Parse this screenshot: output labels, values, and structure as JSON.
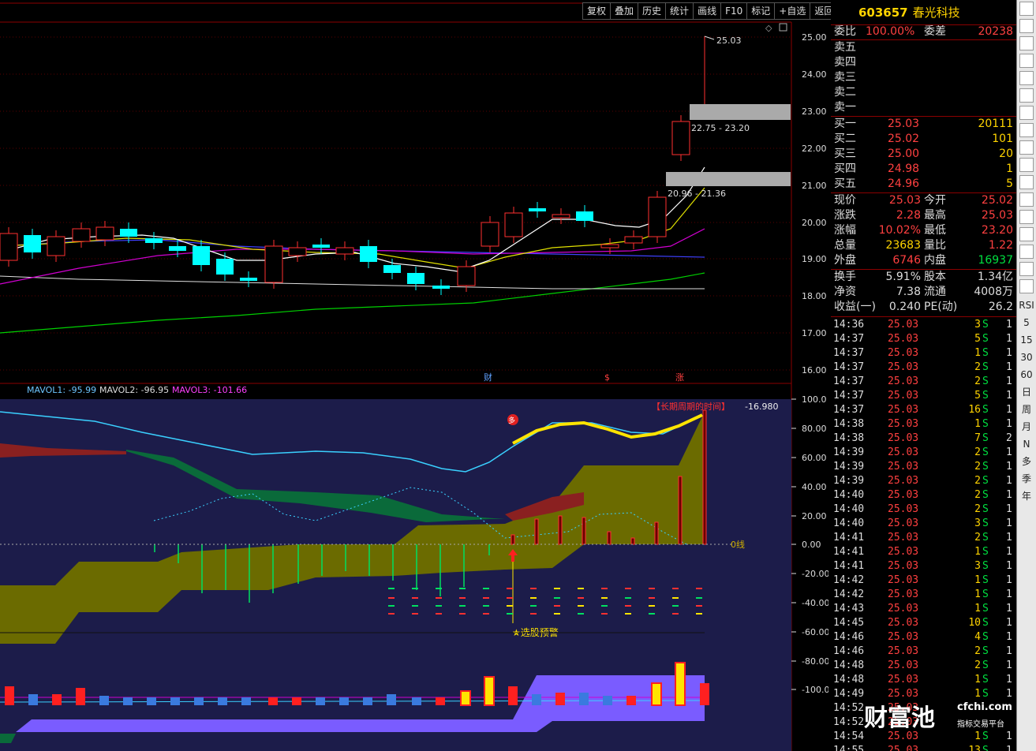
{
  "toolbar": [
    "复权",
    "叠加",
    "历史",
    "统计",
    "画线",
    "F10",
    "标记",
    "+自选",
    "返回"
  ],
  "stock": {
    "code": "603657",
    "name": "春光科技"
  },
  "price_axis": [
    "25.00",
    "24.00",
    "23.00",
    "22.00",
    "21.00",
    "20.00",
    "19.00",
    "18.00",
    "17.00",
    "16.00"
  ],
  "annotations": {
    "high": "25.03",
    "zone_upper": "22.75 - 23.20",
    "zone_lower": "20.96 - 21.36",
    "marker1": "财",
    "marker2": "$",
    "marker3": "涨"
  },
  "indicator": {
    "mavol1": "MAVOL1: -95.99",
    "mavol2": "MAVOL2: -96.95",
    "mavol3": "MAVOL3: -101.66",
    "title": "【长期周期的时间】",
    "value": "-16.980",
    "zero": "0线",
    "alert": "★选股预警",
    "badge": "多",
    "axis": [
      "100.0",
      "80.00",
      "60.00",
      "40.00",
      "20.00",
      "0.00",
      "-20.00",
      "-40.00",
      "-60.00",
      "-80.00",
      "-100.0"
    ]
  },
  "quote": {
    "weibi_label": "委比",
    "weibi": "100.00%",
    "weicha_label": "委差",
    "weicha": "20238",
    "asks": [
      {
        "l": "卖五",
        "p": "",
        "q": ""
      },
      {
        "l": "卖四",
        "p": "",
        "q": ""
      },
      {
        "l": "卖三",
        "p": "",
        "q": ""
      },
      {
        "l": "卖二",
        "p": "",
        "q": ""
      },
      {
        "l": "卖一",
        "p": "",
        "q": ""
      }
    ],
    "bids": [
      {
        "l": "买一",
        "p": "25.03",
        "q": "20111"
      },
      {
        "l": "买二",
        "p": "25.02",
        "q": "101"
      },
      {
        "l": "买三",
        "p": "25.00",
        "q": "20"
      },
      {
        "l": "买四",
        "p": "24.98",
        "q": "1"
      },
      {
        "l": "买五",
        "p": "24.96",
        "q": "5"
      }
    ],
    "stats": [
      {
        "l1": "现价",
        "v1": "25.03",
        "l2": "今开",
        "v2": "25.02"
      },
      {
        "l1": "涨跌",
        "v1": "2.28",
        "l2": "最高",
        "v2": "25.03"
      },
      {
        "l1": "涨幅",
        "v1": "10.02%",
        "l2": "最低",
        "v2": "23.20"
      },
      {
        "l1": "总量",
        "v1": "23683",
        "l2": "量比",
        "v2": "1.22"
      },
      {
        "l1": "外盘",
        "v1": "6746",
        "l2": "内盘",
        "v2": "16937"
      }
    ],
    "stats2": [
      {
        "l1": "换手",
        "v1": "5.91%",
        "l2": "股本",
        "v2": "1.34亿"
      },
      {
        "l1": "净资",
        "v1": "7.38",
        "l2": "流通",
        "v2": "4008万"
      },
      {
        "l1": "收益(一)",
        "v1": "0.240",
        "l2": "PE(动)",
        "v2": "26.2"
      }
    ]
  },
  "ticks": [
    {
      "t": "14:36",
      "p": "25.03",
      "q": "3",
      "s": "S",
      "n": "1"
    },
    {
      "t": "14:37",
      "p": "25.03",
      "q": "5",
      "s": "S",
      "n": "1"
    },
    {
      "t": "14:37",
      "p": "25.03",
      "q": "1",
      "s": "S",
      "n": "1"
    },
    {
      "t": "14:37",
      "p": "25.03",
      "q": "2",
      "s": "S",
      "n": "1"
    },
    {
      "t": "14:37",
      "p": "25.03",
      "q": "2",
      "s": "S",
      "n": "1"
    },
    {
      "t": "14:37",
      "p": "25.03",
      "q": "5",
      "s": "S",
      "n": "1"
    },
    {
      "t": "14:37",
      "p": "25.03",
      "q": "16",
      "s": "S",
      "n": "1"
    },
    {
      "t": "14:38",
      "p": "25.03",
      "q": "1",
      "s": "S",
      "n": "1"
    },
    {
      "t": "14:38",
      "p": "25.03",
      "q": "7",
      "s": "S",
      "n": "2"
    },
    {
      "t": "14:39",
      "p": "25.03",
      "q": "2",
      "s": "S",
      "n": "1"
    },
    {
      "t": "14:39",
      "p": "25.03",
      "q": "2",
      "s": "S",
      "n": "1"
    },
    {
      "t": "14:39",
      "p": "25.03",
      "q": "2",
      "s": "S",
      "n": "1"
    },
    {
      "t": "14:40",
      "p": "25.03",
      "q": "2",
      "s": "S",
      "n": "1"
    },
    {
      "t": "14:40",
      "p": "25.03",
      "q": "2",
      "s": "S",
      "n": "1"
    },
    {
      "t": "14:40",
      "p": "25.03",
      "q": "3",
      "s": "S",
      "n": "1"
    },
    {
      "t": "14:41",
      "p": "25.03",
      "q": "2",
      "s": "S",
      "n": "1"
    },
    {
      "t": "14:41",
      "p": "25.03",
      "q": "1",
      "s": "S",
      "n": "1"
    },
    {
      "t": "14:41",
      "p": "25.03",
      "q": "3",
      "s": "S",
      "n": "1"
    },
    {
      "t": "14:42",
      "p": "25.03",
      "q": "1",
      "s": "S",
      "n": "1"
    },
    {
      "t": "14:42",
      "p": "25.03",
      "q": "1",
      "s": "S",
      "n": "1"
    },
    {
      "t": "14:43",
      "p": "25.03",
      "q": "1",
      "s": "S",
      "n": "1"
    },
    {
      "t": "14:45",
      "p": "25.03",
      "q": "10",
      "s": "S",
      "n": "1"
    },
    {
      "t": "14:46",
      "p": "25.03",
      "q": "4",
      "s": "S",
      "n": "1"
    },
    {
      "t": "14:46",
      "p": "25.03",
      "q": "2",
      "s": "S",
      "n": "1"
    },
    {
      "t": "14:48",
      "p": "25.03",
      "q": "2",
      "s": "S",
      "n": "1"
    },
    {
      "t": "14:48",
      "p": "25.03",
      "q": "1",
      "s": "S",
      "n": "1"
    },
    {
      "t": "14:49",
      "p": "25.03",
      "q": "1",
      "s": "S",
      "n": "1"
    },
    {
      "t": "14:52",
      "p": "25.03",
      "q": "",
      "s": "",
      "n": ""
    },
    {
      "t": "14:52",
      "p": "25.03",
      "q": "",
      "s": "",
      "n": ""
    },
    {
      "t": "14:54",
      "p": "25.03",
      "q": "1",
      "s": "S",
      "n": "1"
    },
    {
      "t": "14:55",
      "p": "25.03",
      "q": "13",
      "s": "S",
      "n": "1"
    }
  ],
  "side_tools": [
    "RSI",
    "5",
    "15",
    "30",
    "60",
    "日",
    "周",
    "月",
    "N",
    "多",
    "季",
    "年"
  ],
  "watermark": {
    "brand": "财富池",
    "site": "cfchi.com",
    "slogan": "指标交易平台"
  },
  "colors": {
    "up": "#ff3030",
    "down": "#00ffff",
    "ma5": "#ffffff",
    "ma10": "#ffff00",
    "ma20": "#ff00ff",
    "ma60": "#00ff00",
    "panel_bg": "#1c1c4a"
  }
}
